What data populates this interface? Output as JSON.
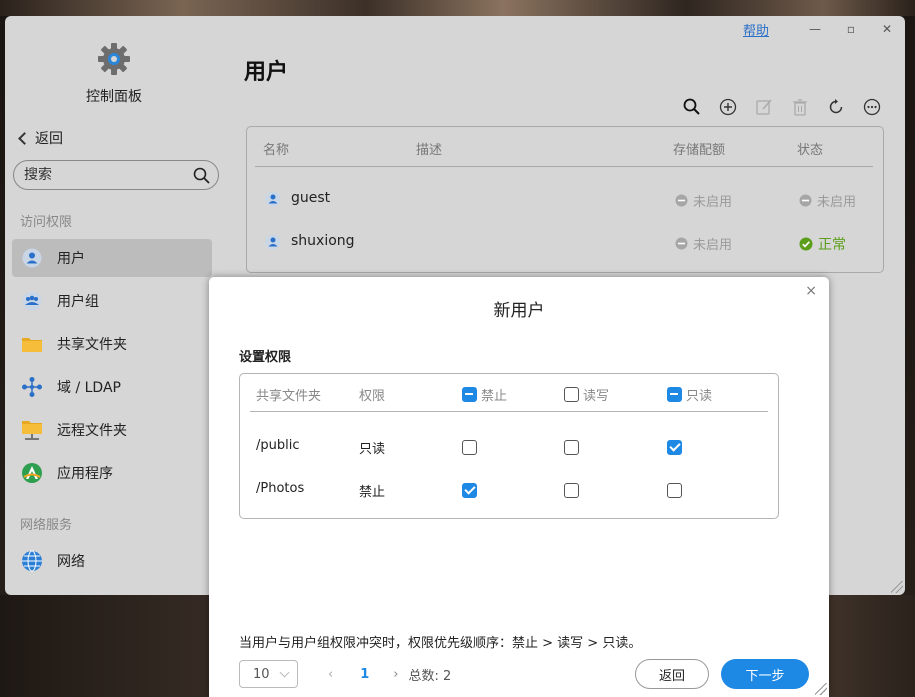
{
  "window": {
    "help_label": "帮助",
    "minimize_glyph": "—",
    "maximize_glyph": "▫",
    "close_glyph": "✕"
  },
  "sidebar": {
    "title": "控制面板",
    "back_label": "返回",
    "search_placeholder": "搜索",
    "section_access": "访问权限",
    "section_network": "网络服务",
    "items": [
      {
        "label": "用户",
        "icon": "user-icon",
        "active": true
      },
      {
        "label": "用户组",
        "icon": "user-group-icon"
      },
      {
        "label": "共享文件夹",
        "icon": "folder-icon"
      },
      {
        "label": "域 / LDAP",
        "icon": "domain-icon"
      },
      {
        "label": "远程文件夹",
        "icon": "remote-folder-icon"
      },
      {
        "label": "应用程序",
        "icon": "app-icon"
      },
      {
        "label": "网络",
        "icon": "globe-icon"
      }
    ]
  },
  "main": {
    "title": "用户",
    "toolbar": [
      "search-icon",
      "add-icon",
      "edit-icon",
      "delete-icon",
      "refresh-icon",
      "more-icon"
    ],
    "columns": {
      "name": "名称",
      "desc": "描述",
      "quota": "存储配额",
      "status": "状态"
    },
    "users": [
      {
        "name": "guest",
        "quota": "未启用",
        "status": "未启用"
      },
      {
        "name": "shuxiong",
        "quota": "未启用",
        "status": "正常"
      }
    ]
  },
  "dialog": {
    "title": "新用户",
    "close_glyph": "×",
    "section": "设置权限",
    "columns": {
      "folder": "共享文件夹",
      "perm": "权限",
      "deny": "禁止",
      "rw": "读写",
      "ro": "只读"
    },
    "rows": [
      {
        "folder": "/public",
        "perm": "只读",
        "deny": false,
        "rw": false,
        "ro": true
      },
      {
        "folder": "/Photos",
        "perm": "禁止",
        "deny": true,
        "rw": false,
        "ro": false
      }
    ],
    "note": "当用户与用户组权限冲突时，权限优先级顺序：禁止 > 读写 > 只读。",
    "page_size": "10",
    "prev_glyph": "‹",
    "next_glyph": "›",
    "current_page": "1",
    "total": "总数: 2",
    "back_button": "返回",
    "next_button": "下一步"
  },
  "colors": {
    "accent": "#1e88e5",
    "ok": "#5a9e1a",
    "window_bg": "#d6d6d6"
  }
}
